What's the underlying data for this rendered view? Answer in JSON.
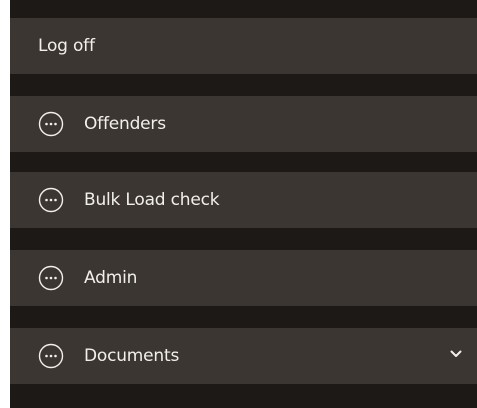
{
  "menu": {
    "log_off_label": "Log off",
    "items": [
      {
        "label": "Offenders",
        "icon": "more-options-icon"
      },
      {
        "label": "Bulk Load check",
        "icon": "more-options-icon"
      },
      {
        "label": "Admin",
        "icon": "more-options-icon"
      },
      {
        "label": "Documents",
        "icon": "more-options-icon",
        "expand_icon": "chevron-down-icon"
      }
    ]
  },
  "colors": {
    "panel_background": "#1c1917",
    "item_background": "#3b3632",
    "text": "#f2f0ec"
  }
}
